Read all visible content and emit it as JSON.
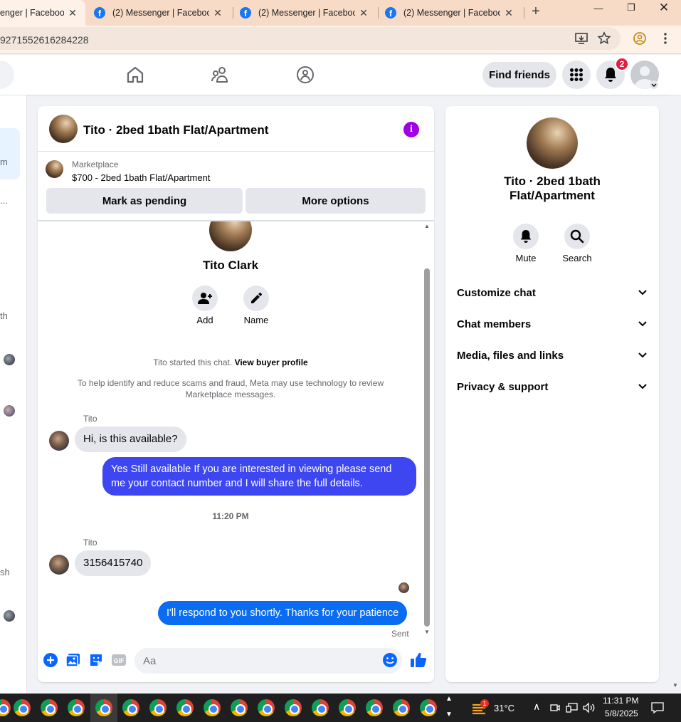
{
  "browser": {
    "tabs": [
      {
        "title": "enger | Facebook",
        "active": true
      },
      {
        "title": "(2) Messenger | Facebook",
        "active": false
      },
      {
        "title": "(2) Messenger | Facebook",
        "active": false
      },
      {
        "title": "(2) Messenger | Facebook",
        "active": false
      }
    ],
    "url": "9271552616284228"
  },
  "nav": {
    "find_friends": "Find friends",
    "notification_count": "2"
  },
  "chat": {
    "title": "Tito · 2bed 1bath Flat/Apartment",
    "marketplace_label": "Marketplace",
    "listing": "$700 - 2bed 1bath Flat/Apartment",
    "mark_pending": "Mark as pending",
    "more_options": "More options",
    "contact_name": "Tito Clark",
    "add_label": "Add",
    "name_label": "Name",
    "started_text": "Tito started this chat.",
    "view_buyer_profile": "View buyer profile",
    "safety_notice": "To help identify and reduce scams and fraud, Meta may use technology to review Marketplace messages.",
    "messages": [
      {
        "sender": "Tito",
        "text": "Hi, is this available?",
        "direction": "in"
      },
      {
        "text": "Yes Still available If you are interested in viewing please send me your contact number and I will share the full details.",
        "direction": "out"
      },
      {
        "timestamp": "11:20 PM"
      },
      {
        "sender": "Tito",
        "text": "3156415740",
        "direction": "in"
      },
      {
        "text": "I'll respond to you shortly. Thanks for your patience",
        "direction": "out"
      }
    ],
    "sent_status": "Sent",
    "composer_placeholder": "Aa"
  },
  "right_panel": {
    "title": "Tito · 2bed 1bath Flat/Apartment",
    "mute": "Mute",
    "search": "Search",
    "sections": [
      "Customize chat",
      "Chat members",
      "Media, files and links",
      "Privacy & support"
    ]
  },
  "left_stub": {
    "snippets": [
      "m",
      "...",
      "th",
      "sh"
    ]
  },
  "taskbar": {
    "weather_temp": "31°C",
    "weather_badge": "1",
    "time": "11:31 PM",
    "date": "5/8/2025"
  },
  "colors": {
    "fb_blue": "#1877f2",
    "outgoing_bubble": "#3d46f0",
    "outgoing_bubble_latest": "#0a6cf0",
    "info_purple": "#a000e6",
    "badge_red": "#e41e3f"
  }
}
